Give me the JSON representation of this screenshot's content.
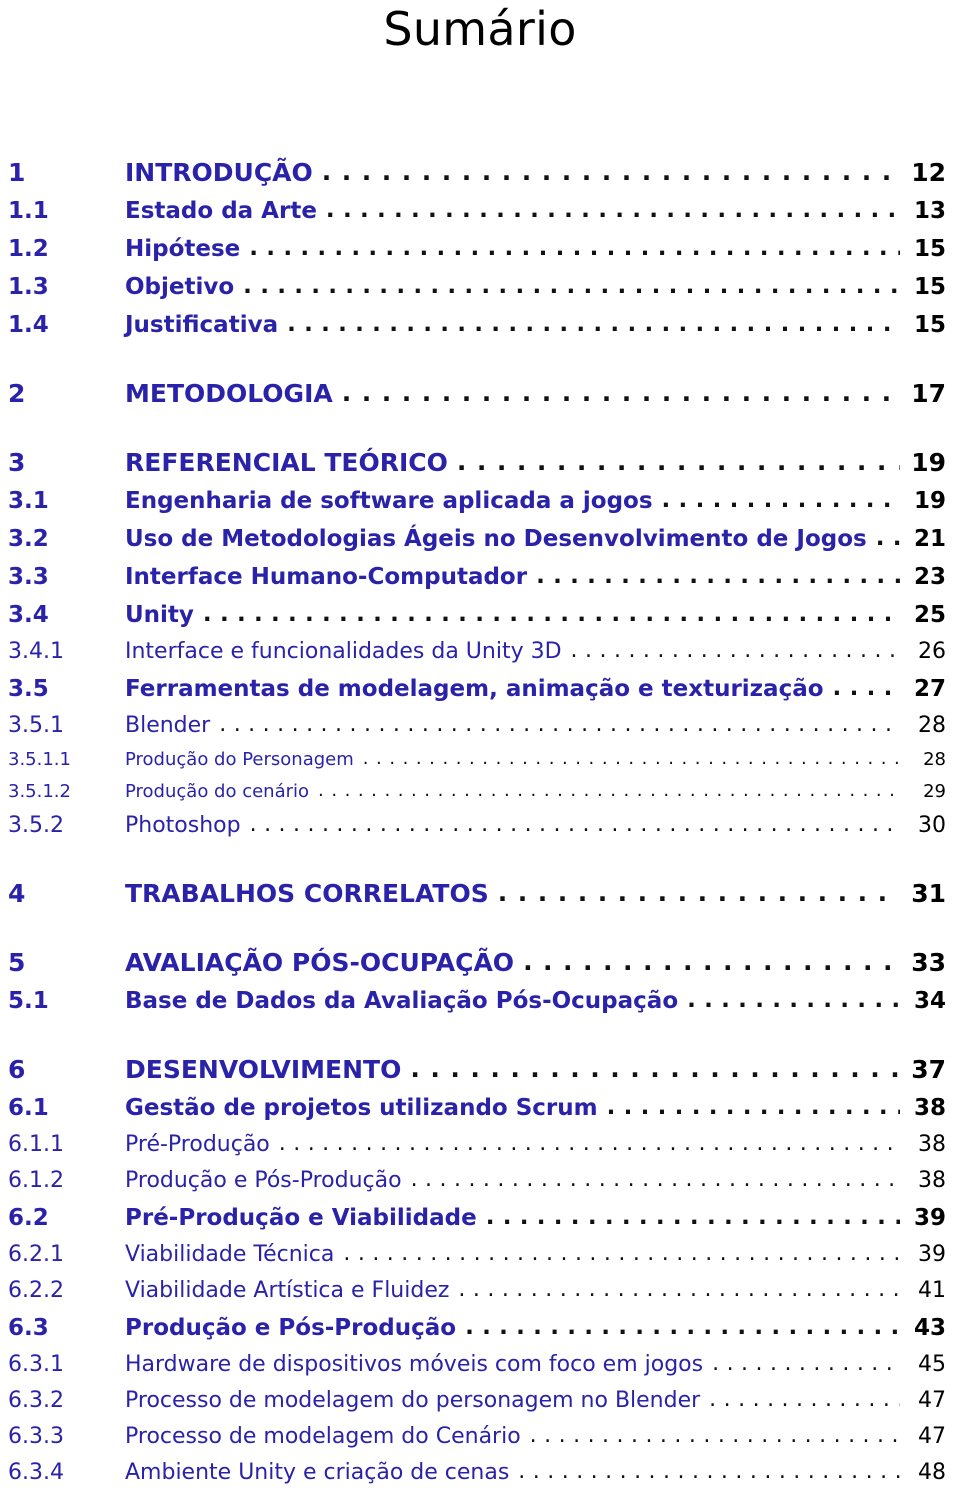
{
  "document": {
    "heading": "Sumário",
    "accent_color": "#2a22a8",
    "page_number_color": "#000000",
    "leader_color": "#111111"
  },
  "toc": {
    "entries": [
      {
        "number": "1",
        "title": "INTRODUÇÃO",
        "page": "12",
        "level": 1
      },
      {
        "number": "1.1",
        "title": "Estado da Arte",
        "page": "13",
        "level": 2
      },
      {
        "number": "1.2",
        "title": "Hipótese",
        "page": "15",
        "level": 2
      },
      {
        "number": "1.3",
        "title": "Objetivo",
        "page": "15",
        "level": 2
      },
      {
        "number": "1.4",
        "title": "Justificativa",
        "page": "15",
        "level": 2
      },
      {
        "number": "2",
        "title": "METODOLOGIA",
        "page": "17",
        "level": 1
      },
      {
        "number": "3",
        "title": "REFERENCIAL TEÓRICO",
        "page": "19",
        "level": 1
      },
      {
        "number": "3.1",
        "title": "Engenharia de software aplicada a jogos",
        "page": "19",
        "level": 2
      },
      {
        "number": "3.2",
        "title": "Uso de Metodologias Ágeis no Desenvolvimento de Jogos",
        "page": "21",
        "level": 2
      },
      {
        "number": "3.3",
        "title": "Interface Humano-Computador",
        "page": "23",
        "level": 2
      },
      {
        "number": "3.4",
        "title": "Unity",
        "page": "25",
        "level": 2
      },
      {
        "number": "3.4.1",
        "title": "Interface e funcionalidades da Unity 3D",
        "page": "26",
        "level": 3
      },
      {
        "number": "3.5",
        "title": "Ferramentas de modelagem, animação e texturização",
        "page": "27",
        "level": 2
      },
      {
        "number": "3.5.1",
        "title": "Blender",
        "page": "28",
        "level": 3
      },
      {
        "number": "3.5.1.1",
        "title": "Produção do Personagem",
        "page": "28",
        "level": 4
      },
      {
        "number": "3.5.1.2",
        "title": "Produção do cenário",
        "page": "29",
        "level": 4
      },
      {
        "number": "3.5.2",
        "title": "Photoshop",
        "page": "30",
        "level": 3
      },
      {
        "number": "4",
        "title": "TRABALHOS CORRELATOS",
        "page": "31",
        "level": 1
      },
      {
        "number": "5",
        "title": "AVALIAÇÃO PÓS-OCUPAÇÃO",
        "page": "33",
        "level": 1
      },
      {
        "number": "5.1",
        "title": "Base de Dados da Avaliação Pós-Ocupação",
        "page": "34",
        "level": 2
      },
      {
        "number": "6",
        "title": "DESENVOLVIMENTO",
        "page": "37",
        "level": 1
      },
      {
        "number": "6.1",
        "title": "Gestão de projetos utilizando Scrum",
        "page": "38",
        "level": 2
      },
      {
        "number": "6.1.1",
        "title": "Pré-Produção",
        "page": "38",
        "level": 3
      },
      {
        "number": "6.1.2",
        "title": "Produção e Pós-Produção",
        "page": "38",
        "level": 3
      },
      {
        "number": "6.2",
        "title": "Pré-Produção e Viabilidade",
        "page": "39",
        "level": 2
      },
      {
        "number": "6.2.1",
        "title": "Viabilidade Técnica",
        "page": "39",
        "level": 3
      },
      {
        "number": "6.2.2",
        "title": "Viabilidade Artística e Fluidez",
        "page": "41",
        "level": 3
      },
      {
        "number": "6.3",
        "title": "Produção e Pós-Produção",
        "page": "43",
        "level": 2
      },
      {
        "number": "6.3.1",
        "title": "Hardware de dispositivos móveis com foco em jogos",
        "page": "45",
        "level": 3
      },
      {
        "number": "6.3.2",
        "title": "Processo de modelagem do personagem no Blender",
        "page": "47",
        "level": 3
      },
      {
        "number": "6.3.3",
        "title": "Processo de modelagem do Cenário",
        "page": "47",
        "level": 3
      },
      {
        "number": "6.3.4",
        "title": "Ambiente Unity e criação de cenas",
        "page": "48",
        "level": 3
      }
    ]
  }
}
